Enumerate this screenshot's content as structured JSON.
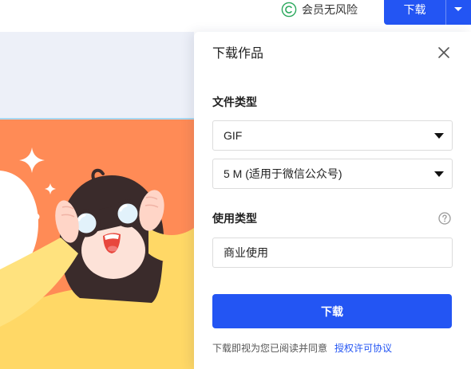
{
  "header": {
    "member_guarantee": "会员无风险",
    "download_button": "下载"
  },
  "panel": {
    "title": "下载作品",
    "file_type": {
      "label": "文件类型",
      "format": "GIF",
      "size": "5 M (适用于微信公众号)"
    },
    "usage_type": {
      "label": "使用类型",
      "value": "商业使用"
    },
    "download_button": "下载",
    "agreement": {
      "text": "下载即视为您已阅读并同意",
      "link": "授权许可协议"
    }
  },
  "icons": {
    "member_guarantee": "circled-c-icon",
    "header_dropdown": "caret-down-icon",
    "close": "close-icon",
    "select_arrow": "caret-down-icon",
    "usage_help": "question-circle-icon"
  },
  "colors": {
    "accent": "#2355f3",
    "guarantee_green": "#2aa85c",
    "canvas_background": "#edf0f8",
    "illustration_orange": "#ff8b56",
    "shirt_yellow": "#ffd866"
  }
}
